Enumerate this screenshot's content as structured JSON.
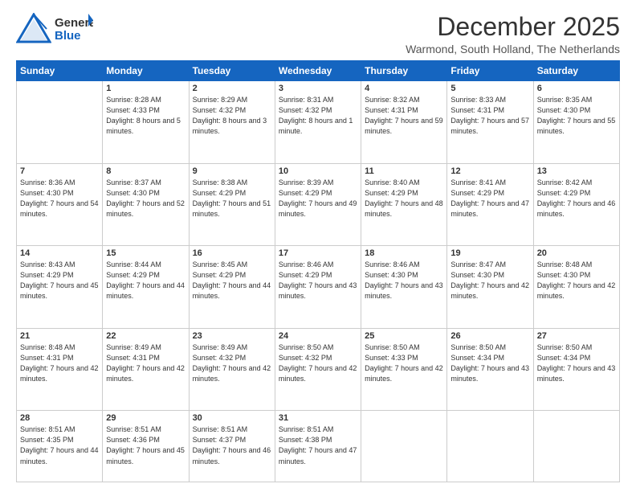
{
  "header": {
    "logo_general": "General",
    "logo_blue": "Blue",
    "month_year": "December 2025",
    "location": "Warmond, South Holland, The Netherlands"
  },
  "columns": [
    "Sunday",
    "Monday",
    "Tuesday",
    "Wednesday",
    "Thursday",
    "Friday",
    "Saturday"
  ],
  "weeks": [
    [
      {
        "day": "",
        "sunrise": "",
        "sunset": "",
        "daylight": ""
      },
      {
        "day": "1",
        "sunrise": "Sunrise: 8:28 AM",
        "sunset": "Sunset: 4:33 PM",
        "daylight": "Daylight: 8 hours and 5 minutes."
      },
      {
        "day": "2",
        "sunrise": "Sunrise: 8:29 AM",
        "sunset": "Sunset: 4:32 PM",
        "daylight": "Daylight: 8 hours and 3 minutes."
      },
      {
        "day": "3",
        "sunrise": "Sunrise: 8:31 AM",
        "sunset": "Sunset: 4:32 PM",
        "daylight": "Daylight: 8 hours and 1 minute."
      },
      {
        "day": "4",
        "sunrise": "Sunrise: 8:32 AM",
        "sunset": "Sunset: 4:31 PM",
        "daylight": "Daylight: 7 hours and 59 minutes."
      },
      {
        "day": "5",
        "sunrise": "Sunrise: 8:33 AM",
        "sunset": "Sunset: 4:31 PM",
        "daylight": "Daylight: 7 hours and 57 minutes."
      },
      {
        "day": "6",
        "sunrise": "Sunrise: 8:35 AM",
        "sunset": "Sunset: 4:30 PM",
        "daylight": "Daylight: 7 hours and 55 minutes."
      }
    ],
    [
      {
        "day": "7",
        "sunrise": "Sunrise: 8:36 AM",
        "sunset": "Sunset: 4:30 PM",
        "daylight": "Daylight: 7 hours and 54 minutes."
      },
      {
        "day": "8",
        "sunrise": "Sunrise: 8:37 AM",
        "sunset": "Sunset: 4:30 PM",
        "daylight": "Daylight: 7 hours and 52 minutes."
      },
      {
        "day": "9",
        "sunrise": "Sunrise: 8:38 AM",
        "sunset": "Sunset: 4:29 PM",
        "daylight": "Daylight: 7 hours and 51 minutes."
      },
      {
        "day": "10",
        "sunrise": "Sunrise: 8:39 AM",
        "sunset": "Sunset: 4:29 PM",
        "daylight": "Daylight: 7 hours and 49 minutes."
      },
      {
        "day": "11",
        "sunrise": "Sunrise: 8:40 AM",
        "sunset": "Sunset: 4:29 PM",
        "daylight": "Daylight: 7 hours and 48 minutes."
      },
      {
        "day": "12",
        "sunrise": "Sunrise: 8:41 AM",
        "sunset": "Sunset: 4:29 PM",
        "daylight": "Daylight: 7 hours and 47 minutes."
      },
      {
        "day": "13",
        "sunrise": "Sunrise: 8:42 AM",
        "sunset": "Sunset: 4:29 PM",
        "daylight": "Daylight: 7 hours and 46 minutes."
      }
    ],
    [
      {
        "day": "14",
        "sunrise": "Sunrise: 8:43 AM",
        "sunset": "Sunset: 4:29 PM",
        "daylight": "Daylight: 7 hours and 45 minutes."
      },
      {
        "day": "15",
        "sunrise": "Sunrise: 8:44 AM",
        "sunset": "Sunset: 4:29 PM",
        "daylight": "Daylight: 7 hours and 44 minutes."
      },
      {
        "day": "16",
        "sunrise": "Sunrise: 8:45 AM",
        "sunset": "Sunset: 4:29 PM",
        "daylight": "Daylight: 7 hours and 44 minutes."
      },
      {
        "day": "17",
        "sunrise": "Sunrise: 8:46 AM",
        "sunset": "Sunset: 4:29 PM",
        "daylight": "Daylight: 7 hours and 43 minutes."
      },
      {
        "day": "18",
        "sunrise": "Sunrise: 8:46 AM",
        "sunset": "Sunset: 4:30 PM",
        "daylight": "Daylight: 7 hours and 43 minutes."
      },
      {
        "day": "19",
        "sunrise": "Sunrise: 8:47 AM",
        "sunset": "Sunset: 4:30 PM",
        "daylight": "Daylight: 7 hours and 42 minutes."
      },
      {
        "day": "20",
        "sunrise": "Sunrise: 8:48 AM",
        "sunset": "Sunset: 4:30 PM",
        "daylight": "Daylight: 7 hours and 42 minutes."
      }
    ],
    [
      {
        "day": "21",
        "sunrise": "Sunrise: 8:48 AM",
        "sunset": "Sunset: 4:31 PM",
        "daylight": "Daylight: 7 hours and 42 minutes."
      },
      {
        "day": "22",
        "sunrise": "Sunrise: 8:49 AM",
        "sunset": "Sunset: 4:31 PM",
        "daylight": "Daylight: 7 hours and 42 minutes."
      },
      {
        "day": "23",
        "sunrise": "Sunrise: 8:49 AM",
        "sunset": "Sunset: 4:32 PM",
        "daylight": "Daylight: 7 hours and 42 minutes."
      },
      {
        "day": "24",
        "sunrise": "Sunrise: 8:50 AM",
        "sunset": "Sunset: 4:32 PM",
        "daylight": "Daylight: 7 hours and 42 minutes."
      },
      {
        "day": "25",
        "sunrise": "Sunrise: 8:50 AM",
        "sunset": "Sunset: 4:33 PM",
        "daylight": "Daylight: 7 hours and 42 minutes."
      },
      {
        "day": "26",
        "sunrise": "Sunrise: 8:50 AM",
        "sunset": "Sunset: 4:34 PM",
        "daylight": "Daylight: 7 hours and 43 minutes."
      },
      {
        "day": "27",
        "sunrise": "Sunrise: 8:50 AM",
        "sunset": "Sunset: 4:34 PM",
        "daylight": "Daylight: 7 hours and 43 minutes."
      }
    ],
    [
      {
        "day": "28",
        "sunrise": "Sunrise: 8:51 AM",
        "sunset": "Sunset: 4:35 PM",
        "daylight": "Daylight: 7 hours and 44 minutes."
      },
      {
        "day": "29",
        "sunrise": "Sunrise: 8:51 AM",
        "sunset": "Sunset: 4:36 PM",
        "daylight": "Daylight: 7 hours and 45 minutes."
      },
      {
        "day": "30",
        "sunrise": "Sunrise: 8:51 AM",
        "sunset": "Sunset: 4:37 PM",
        "daylight": "Daylight: 7 hours and 46 minutes."
      },
      {
        "day": "31",
        "sunrise": "Sunrise: 8:51 AM",
        "sunset": "Sunset: 4:38 PM",
        "daylight": "Daylight: 7 hours and 47 minutes."
      },
      {
        "day": "",
        "sunrise": "",
        "sunset": "",
        "daylight": ""
      },
      {
        "day": "",
        "sunrise": "",
        "sunset": "",
        "daylight": ""
      },
      {
        "day": "",
        "sunrise": "",
        "sunset": "",
        "daylight": ""
      }
    ]
  ]
}
